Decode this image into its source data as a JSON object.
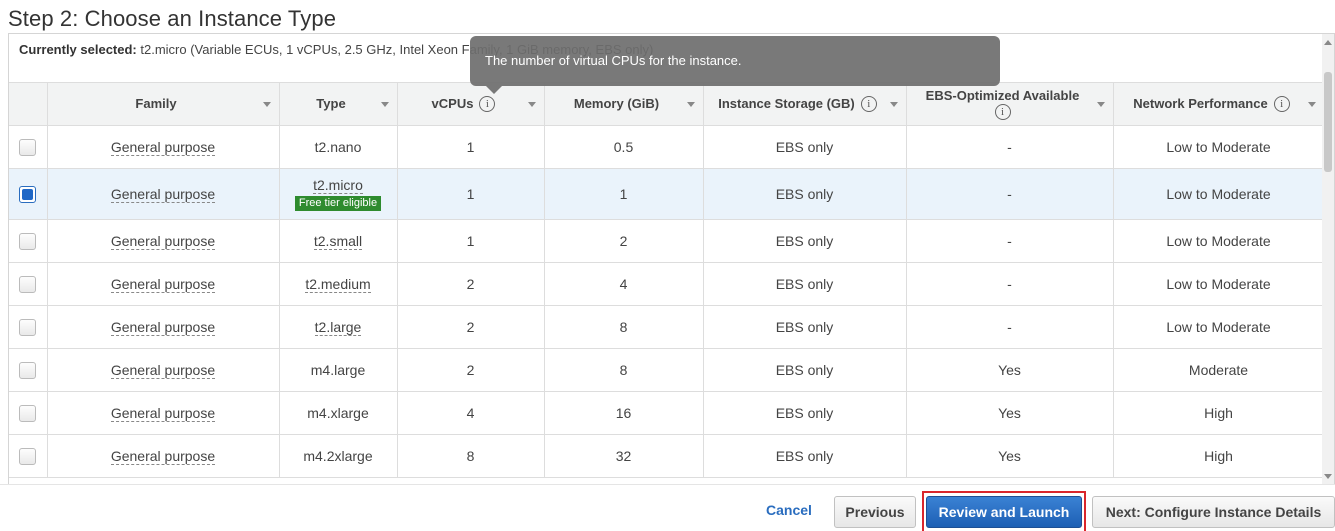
{
  "page": {
    "title": "Step 2: Choose an Instance Type"
  },
  "current": {
    "label": "Currently selected:",
    "value": "t2.micro (Variable ECUs, 1 vCPUs, 2.5 GHz, Intel Xeon Family, 1 GiB memory, EBS only)"
  },
  "tooltip": {
    "text": "The number of virtual CPUs for the instance."
  },
  "table": {
    "headers": {
      "family": "Family",
      "type": "Type",
      "vcpus": "vCPUs",
      "memory": "Memory (GiB)",
      "storage": "Instance Storage (GB)",
      "ebs": "EBS-Optimized Available",
      "network": "Network Performance"
    },
    "rows": [
      {
        "family": "General purpose",
        "type": "t2.nano",
        "vcpus": "1",
        "memory": "0.5",
        "storage": "EBS only",
        "ebs": "-",
        "network": "Low to Moderate",
        "selected": false
      },
      {
        "family": "General purpose",
        "type": "t2.micro",
        "badge": "Free tier eligible",
        "vcpus": "1",
        "memory": "1",
        "storage": "EBS only",
        "ebs": "-",
        "network": "Low to Moderate",
        "selected": true
      },
      {
        "family": "General purpose",
        "type": "t2.small",
        "vcpus": "1",
        "memory": "2",
        "storage": "EBS only",
        "ebs": "-",
        "network": "Low to Moderate",
        "selected": false
      },
      {
        "family": "General purpose",
        "type": "t2.medium",
        "vcpus": "2",
        "memory": "4",
        "storage": "EBS only",
        "ebs": "-",
        "network": "Low to Moderate",
        "selected": false
      },
      {
        "family": "General purpose",
        "type": "t2.large",
        "vcpus": "2",
        "memory": "8",
        "storage": "EBS only",
        "ebs": "-",
        "network": "Low to Moderate",
        "selected": false
      },
      {
        "family": "General purpose",
        "type": "m4.large",
        "vcpus": "2",
        "memory": "8",
        "storage": "EBS only",
        "ebs": "Yes",
        "network": "Moderate",
        "selected": false
      },
      {
        "family": "General purpose",
        "type": "m4.xlarge",
        "vcpus": "4",
        "memory": "16",
        "storage": "EBS only",
        "ebs": "Yes",
        "network": "High",
        "selected": false
      },
      {
        "family": "General purpose",
        "type": "m4.2xlarge",
        "vcpus": "8",
        "memory": "32",
        "storage": "EBS only",
        "ebs": "Yes",
        "network": "High",
        "selected": false
      }
    ]
  },
  "footer": {
    "cancel": "Cancel",
    "previous": "Previous",
    "review": "Review and Launch",
    "next": "Next: Configure Instance Details"
  },
  "colors": {
    "accent": "#1f67c6",
    "badge": "#2e8b2e",
    "highlight_border": "#d9262c",
    "selected_row": "#eaf3fb"
  }
}
